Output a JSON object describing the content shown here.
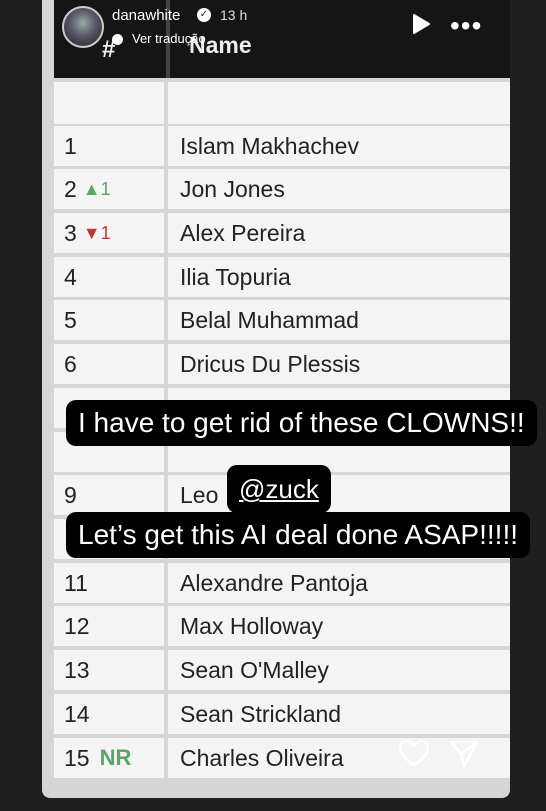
{
  "story": {
    "username": "danawhite",
    "time": "13 h",
    "translate_label": "Ver tradução",
    "verified_icon": "verified-badge-icon",
    "play_icon": "play-icon",
    "more_icon": "more-horizontal-icon"
  },
  "table": {
    "header_num": "#",
    "header_name": "Name",
    "rows": [
      {
        "num": "1",
        "delta": "",
        "name": "Islam Makhachev"
      },
      {
        "num": "2",
        "delta": "▲1",
        "delta_color": "#55a868",
        "name": "Jon Jones"
      },
      {
        "num": "3",
        "delta": "▼1",
        "delta_color": "#c0392b",
        "name": "Alex Pereira"
      },
      {
        "num": "4",
        "delta": "",
        "name": "Ilia Topuria"
      },
      {
        "num": "5",
        "delta": "",
        "name": "Belal Muhammad"
      },
      {
        "num": "6",
        "delta": "",
        "name": "Dricus Du Plessis"
      },
      {
        "num": "9",
        "delta": "",
        "name": "Leo"
      },
      {
        "num": "11",
        "delta": "",
        "name": "Alexandre Pantoja"
      },
      {
        "num": "12",
        "delta": "",
        "name": "Max Holloway"
      },
      {
        "num": "13",
        "delta": "",
        "name": "Sean O'Malley"
      },
      {
        "num": "14",
        "delta": "",
        "name": "Sean Strickland"
      },
      {
        "num": "15",
        "delta": "NR",
        "delta_color": "#55a868",
        "name": "Charles Oliveira"
      }
    ]
  },
  "captions": {
    "line1": "I have to get rid of these CLOWNS!!",
    "mention": "@zuck",
    "line2": "Let’s get this AI deal done ASAP!!!!!"
  },
  "actions": {
    "like_icon": "heart-icon",
    "share_icon": "send-icon"
  }
}
